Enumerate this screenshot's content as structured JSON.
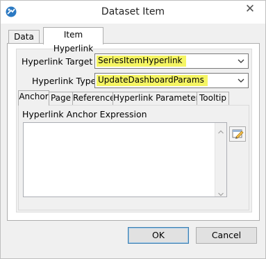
{
  "window": {
    "title": "Dataset Item",
    "close_glyph": "✕"
  },
  "outer_tabs": {
    "data_label": "Data",
    "hyperlink_label": "Item Hyperlink"
  },
  "form": {
    "hyperlink_target_label": "Hyperlink Target",
    "hyperlink_target_value": "SeriesItemHyperlink",
    "hyperlink_type_label": "Hyperlink Type",
    "hyperlink_type_value": "UpdateDashboardParams"
  },
  "inner_tabs": {
    "anchor": "Anchor",
    "page": "Page",
    "reference": "Reference",
    "hyperlink_parameters": "Hyperlink Parameters",
    "tooltip": "Tooltip"
  },
  "anchor": {
    "expression_label": "Hyperlink Anchor Expression",
    "expression_value": ""
  },
  "buttons": {
    "ok": "OK",
    "cancel": "Cancel"
  },
  "colors": {
    "highlight": "#f5f563",
    "ok_border": "#3c7fb1"
  },
  "icons": {
    "app": "app-logo-icon",
    "close": "close-icon",
    "dropdown": "chevron-down-icon",
    "expression_editor": "expression-editor-icon"
  }
}
